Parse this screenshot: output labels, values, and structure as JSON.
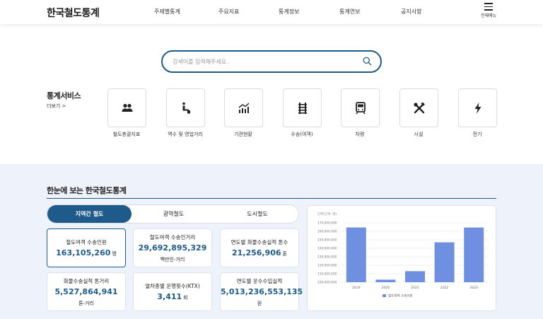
{
  "header": {
    "logo": "한국철도통계",
    "nav": [
      "주제별통계",
      "주요지표",
      "통계정보",
      "통계연보",
      "공지사항"
    ],
    "menu_label": "전체메뉴"
  },
  "search": {
    "placeholder": "검색어를 입력해주세요."
  },
  "services": {
    "title": "통계서비스",
    "more": "더보기 >",
    "items": [
      {
        "label": "철도총괄지표",
        "icon": "people-icon"
      },
      {
        "label": "역수 및 영업거리",
        "icon": "seat-icon"
      },
      {
        "label": "기관현황",
        "icon": "trend-chart-icon"
      },
      {
        "label": "수송(여객)",
        "icon": "rail-track-icon"
      },
      {
        "label": "차량",
        "icon": "train-icon"
      },
      {
        "label": "시설",
        "icon": "tools-icon"
      },
      {
        "label": "전기",
        "icon": "lightning-icon"
      }
    ]
  },
  "overview": {
    "title": "한눈에 보는 한국철도통계",
    "tabs": [
      "지역간 철도",
      "광역철도",
      "도시철도"
    ],
    "active_tab": 0,
    "cards": [
      {
        "label": "철도여객 수송인원",
        "value": "163,105,260",
        "unit": "명",
        "unit_below": ""
      },
      {
        "label": "철도여객 수송인거리",
        "value": "29,692,895,329",
        "unit": "",
        "unit_below": "백만인-거리"
      },
      {
        "label": "연도별 화물수송실적 톤수",
        "value": "21,256,906",
        "unit": "톤",
        "unit_below": ""
      },
      {
        "label": "화물수송실적 톤거리",
        "value": "5,527,864,941",
        "unit": "",
        "unit_below": "톤-거리"
      },
      {
        "label": "열차종별 운행횟수(KTX)",
        "value": "3,411",
        "unit": "회",
        "unit_below": ""
      },
      {
        "label": "연도별 운수수입실적",
        "value": "5,013,236,553,135",
        "unit": "",
        "unit_below": "원"
      }
    ]
  },
  "colors": {
    "primary": "#1e5a8a",
    "bar": "#6f8fe0",
    "section_bg": "#eef2fa"
  },
  "chart_data": {
    "type": "bar",
    "unit_label": "단위(단위: 명)",
    "categories": [
      "2019",
      "2020",
      "2021",
      "2022",
      "2023"
    ],
    "series": [
      {
        "name": "철도여객 수송인원",
        "values": [
          164500000,
          103000000,
          113000000,
          147000000,
          164500000
        ]
      }
    ],
    "y_ticks": [
      "100,000,000",
      "110,000,000",
      "120,000,000",
      "130,000,000",
      "140,000,000",
      "150,000,000",
      "160,000,000",
      "170,000,000"
    ],
    "ylim": [
      100000000,
      170000000
    ],
    "grid": true,
    "legend": "bottom"
  }
}
